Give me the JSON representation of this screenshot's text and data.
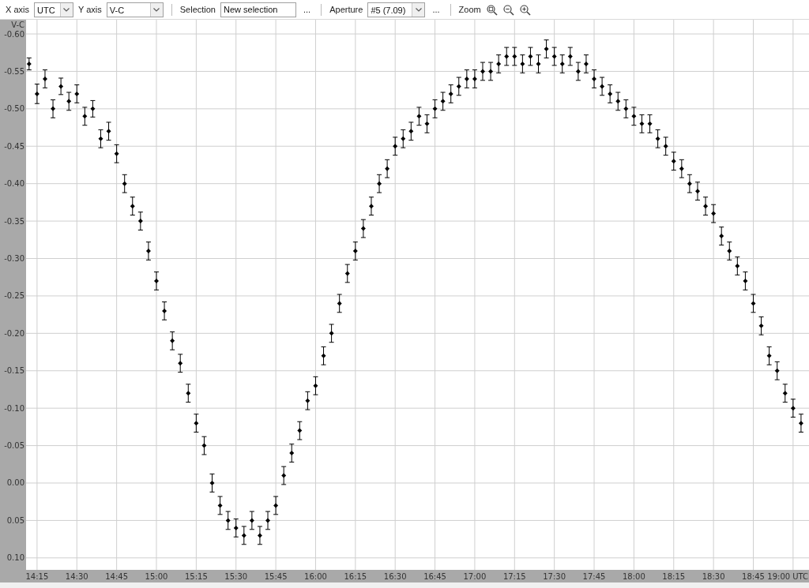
{
  "toolbar": {
    "x_axis": {
      "label": "X axis",
      "value": "UTC"
    },
    "y_axis": {
      "label": "Y axis",
      "value": "V-C"
    },
    "selection": {
      "label": "Selection",
      "value": "New selection",
      "more": "..."
    },
    "aperture": {
      "label": "Aperture",
      "value": "#5 (7.09)",
      "more": "..."
    },
    "zoom": {
      "label": "Zoom"
    }
  },
  "chart": {
    "chart_data": {
      "type": "scatter",
      "xlabel": "UTC",
      "ylabel": "V-C",
      "grid": true,
      "xlim": [
        14.181,
        19.1
      ],
      "ylim": [
        0.116,
        -0.619
      ],
      "xticks": [
        {
          "value": 14.25,
          "label": "14:15"
        },
        {
          "value": 14.5,
          "label": "14:30"
        },
        {
          "value": 14.75,
          "label": "14:45"
        },
        {
          "value": 15,
          "label": "15:00"
        },
        {
          "value": 15.25,
          "label": "15:15"
        },
        {
          "value": 15.5,
          "label": "15:30"
        },
        {
          "value": 15.75,
          "label": "15:45"
        },
        {
          "value": 16,
          "label": "16:00"
        },
        {
          "value": 16.25,
          "label": "16:15"
        },
        {
          "value": 16.5,
          "label": "16:30"
        },
        {
          "value": 16.75,
          "label": "16:45"
        },
        {
          "value": 17,
          "label": "17:00"
        },
        {
          "value": 17.25,
          "label": "17:15"
        },
        {
          "value": 17.5,
          "label": "17:30"
        },
        {
          "value": 17.75,
          "label": "17:45"
        },
        {
          "value": 18,
          "label": "18:00"
        },
        {
          "value": 18.25,
          "label": "18:15"
        },
        {
          "value": 18.5,
          "label": "18:30"
        },
        {
          "value": 18.75,
          "label": "18:45"
        },
        {
          "value": 19,
          "label": "19:00"
        }
      ],
      "yticks": [
        {
          "value": -0.6,
          "label": "-0.60"
        },
        {
          "value": -0.55,
          "label": "-0.55"
        },
        {
          "value": -0.5,
          "label": "-0.50"
        },
        {
          "value": -0.45,
          "label": "-0.45"
        },
        {
          "value": -0.4,
          "label": "-0.40"
        },
        {
          "value": -0.35,
          "label": "-0.35"
        },
        {
          "value": -0.3,
          "label": "-0.30"
        },
        {
          "value": -0.25,
          "label": "-0.25"
        },
        {
          "value": -0.2,
          "label": "-0.20"
        },
        {
          "value": -0.15,
          "label": "-0.15"
        },
        {
          "value": -0.1,
          "label": "-0.10"
        },
        {
          "value": -0.05,
          "label": "-0.05"
        },
        {
          "value": 0,
          "label": "0.00"
        },
        {
          "value": 0.05,
          "label": "0.05"
        },
        {
          "value": 0.1,
          "label": "0.10"
        }
      ],
      "x": [
        14.2,
        14.25,
        14.3,
        14.35,
        14.4,
        14.45,
        14.5,
        14.55,
        14.6,
        14.65,
        14.7,
        14.75,
        14.8,
        14.85,
        14.9,
        14.95,
        15.0,
        15.05,
        15.1,
        15.15,
        15.2,
        15.25,
        15.3,
        15.35,
        15.4,
        15.45,
        15.5,
        15.55,
        15.6,
        15.65,
        15.7,
        15.75,
        15.8,
        15.85,
        15.9,
        15.95,
        16.0,
        16.05,
        16.1,
        16.15,
        16.2,
        16.25,
        16.3,
        16.35,
        16.4,
        16.45,
        16.5,
        16.55,
        16.6,
        16.65,
        16.7,
        16.75,
        16.8,
        16.85,
        16.9,
        16.95,
        17.0,
        17.05,
        17.1,
        17.15,
        17.2,
        17.25,
        17.3,
        17.35,
        17.4,
        17.45,
        17.5,
        17.55,
        17.6,
        17.65,
        17.7,
        17.75,
        17.8,
        17.85,
        17.9,
        17.95,
        18.0,
        18.05,
        18.1,
        18.15,
        18.2,
        18.25,
        18.3,
        18.35,
        18.4,
        18.45,
        18.5,
        18.55,
        18.6,
        18.65,
        18.7,
        18.75,
        18.8,
        18.85,
        18.9,
        18.95,
        19.0,
        19.05
      ],
      "series": [
        {
          "color": "#000000",
          "errors": [
            0.008,
            0.013,
            0.012,
            0.012,
            0.011,
            0.012,
            0.012,
            0.012,
            0.011,
            0.012,
            0.012,
            0.012,
            0.012,
            0.012,
            0.012,
            0.012,
            0.012,
            0.012,
            0.012,
            0.012,
            0.012,
            0.012,
            0.012,
            0.012,
            0.012,
            0.012,
            0.012,
            0.012,
            0.012,
            0.012,
            0.012,
            0.012,
            0.012,
            0.012,
            0.012,
            0.012,
            0.012,
            0.012,
            0.012,
            0.012,
            0.012,
            0.012,
            0.012,
            0.012,
            0.012,
            0.012,
            0.012,
            0.012,
            0.012,
            0.012,
            0.012,
            0.012,
            0.012,
            0.012,
            0.012,
            0.012,
            0.012,
            0.012,
            0.012,
            0.012,
            0.012,
            0.012,
            0.012,
            0.012,
            0.012,
            0.012,
            0.012,
            0.012,
            0.012,
            0.012,
            0.012,
            0.012,
            0.012,
            0.012,
            0.012,
            0.012,
            0.012,
            0.012,
            0.012,
            0.012,
            0.012,
            0.012,
            0.012,
            0.012,
            0.012,
            0.012,
            0.012,
            0.012,
            0.012,
            0.012,
            0.012,
            0.012,
            0.012,
            0.012,
            0.012,
            0.012,
            0.012,
            0.012
          ],
          "values": [
            -0.56,
            -0.52,
            -0.54,
            -0.5,
            -0.53,
            -0.51,
            -0.52,
            -0.49,
            -0.5,
            -0.46,
            -0.47,
            -0.44,
            -0.4,
            -0.37,
            -0.35,
            -0.31,
            -0.27,
            -0.23,
            -0.19,
            -0.16,
            -0.12,
            -0.08,
            -0.05,
            0.0,
            0.03,
            0.05,
            0.06,
            0.07,
            0.05,
            0.07,
            0.05,
            0.03,
            -0.01,
            -0.04,
            -0.07,
            -0.11,
            -0.13,
            -0.17,
            -0.2,
            -0.24,
            -0.28,
            -0.31,
            -0.34,
            -0.37,
            -0.4,
            -0.42,
            -0.45,
            -0.46,
            -0.47,
            -0.49,
            -0.48,
            -0.5,
            -0.51,
            -0.52,
            -0.53,
            -0.54,
            -0.54,
            -0.55,
            -0.55,
            -0.56,
            -0.57,
            -0.57,
            -0.56,
            -0.57,
            -0.56,
            -0.58,
            -0.57,
            -0.56,
            -0.57,
            -0.55,
            -0.56,
            -0.54,
            -0.53,
            -0.52,
            -0.51,
            -0.5,
            -0.49,
            -0.48,
            -0.48,
            -0.46,
            -0.45,
            -0.43,
            -0.42,
            -0.4,
            -0.39,
            -0.37,
            -0.36,
            -0.33,
            -0.31,
            -0.29,
            -0.27,
            -0.24,
            -0.21,
            -0.17,
            -0.15,
            -0.12,
            -0.1,
            -0.08
          ]
        }
      ]
    }
  }
}
